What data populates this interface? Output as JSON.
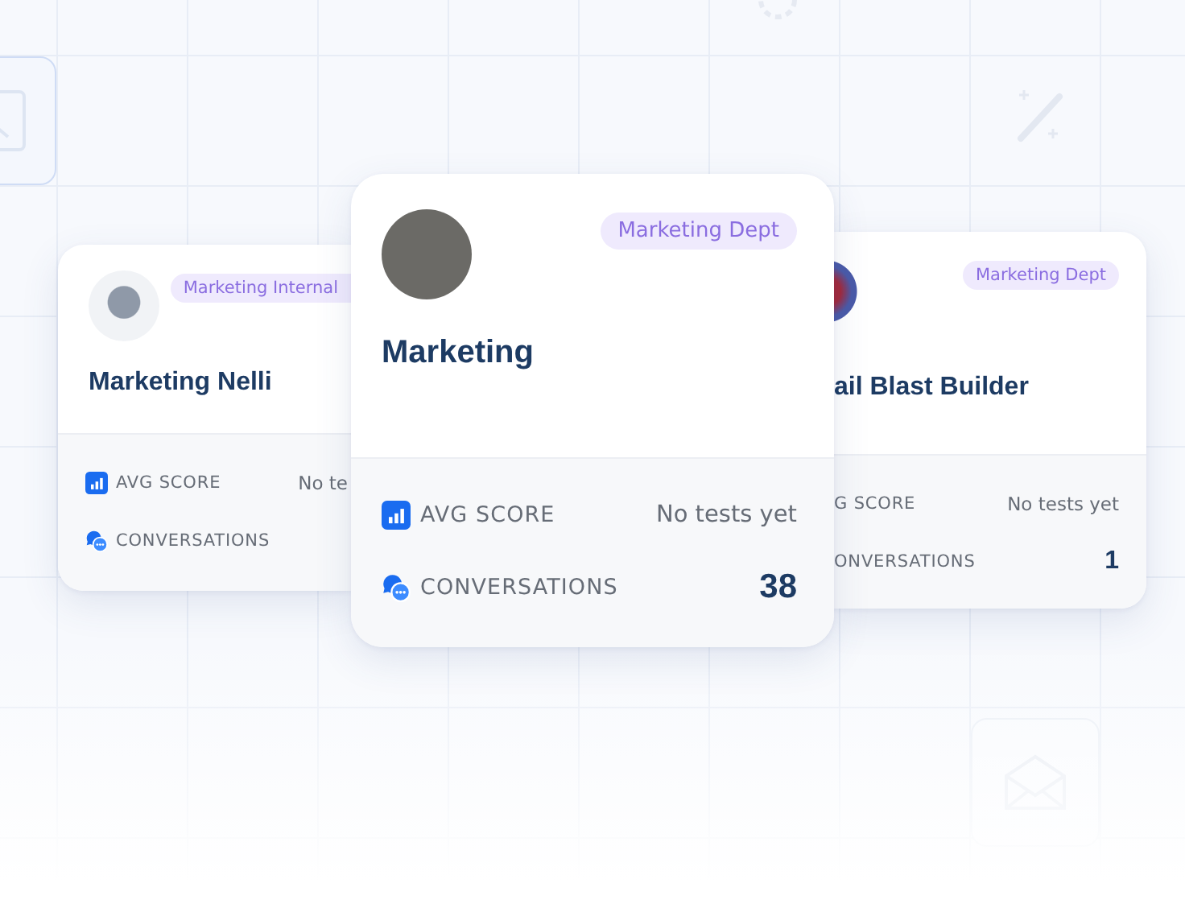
{
  "cards": [
    {
      "badge": "Marketing Internal",
      "title": "Marketing Nelli",
      "stats": [
        {
          "kind": "text",
          "label": "AVG SCORE",
          "value": "No te"
        },
        {
          "kind": "count",
          "label": "CONVERSATIONS"
        }
      ]
    },
    {
      "badge": "Marketing Dept",
      "title": "Marketing",
      "stats": [
        {
          "kind": "text",
          "label": "AVG SCORE",
          "value": "No tests yet"
        },
        {
          "kind": "count",
          "label": "CONVERSATIONS",
          "value": "38"
        }
      ]
    },
    {
      "badge": "Marketing Dept",
      "title": "ail Blast Builder",
      "stats": [
        {
          "kind": "text",
          "label": "G SCORE",
          "value": "No tests yet"
        },
        {
          "kind": "count",
          "label": "ONVERSATIONS",
          "value": "1"
        }
      ]
    }
  ]
}
